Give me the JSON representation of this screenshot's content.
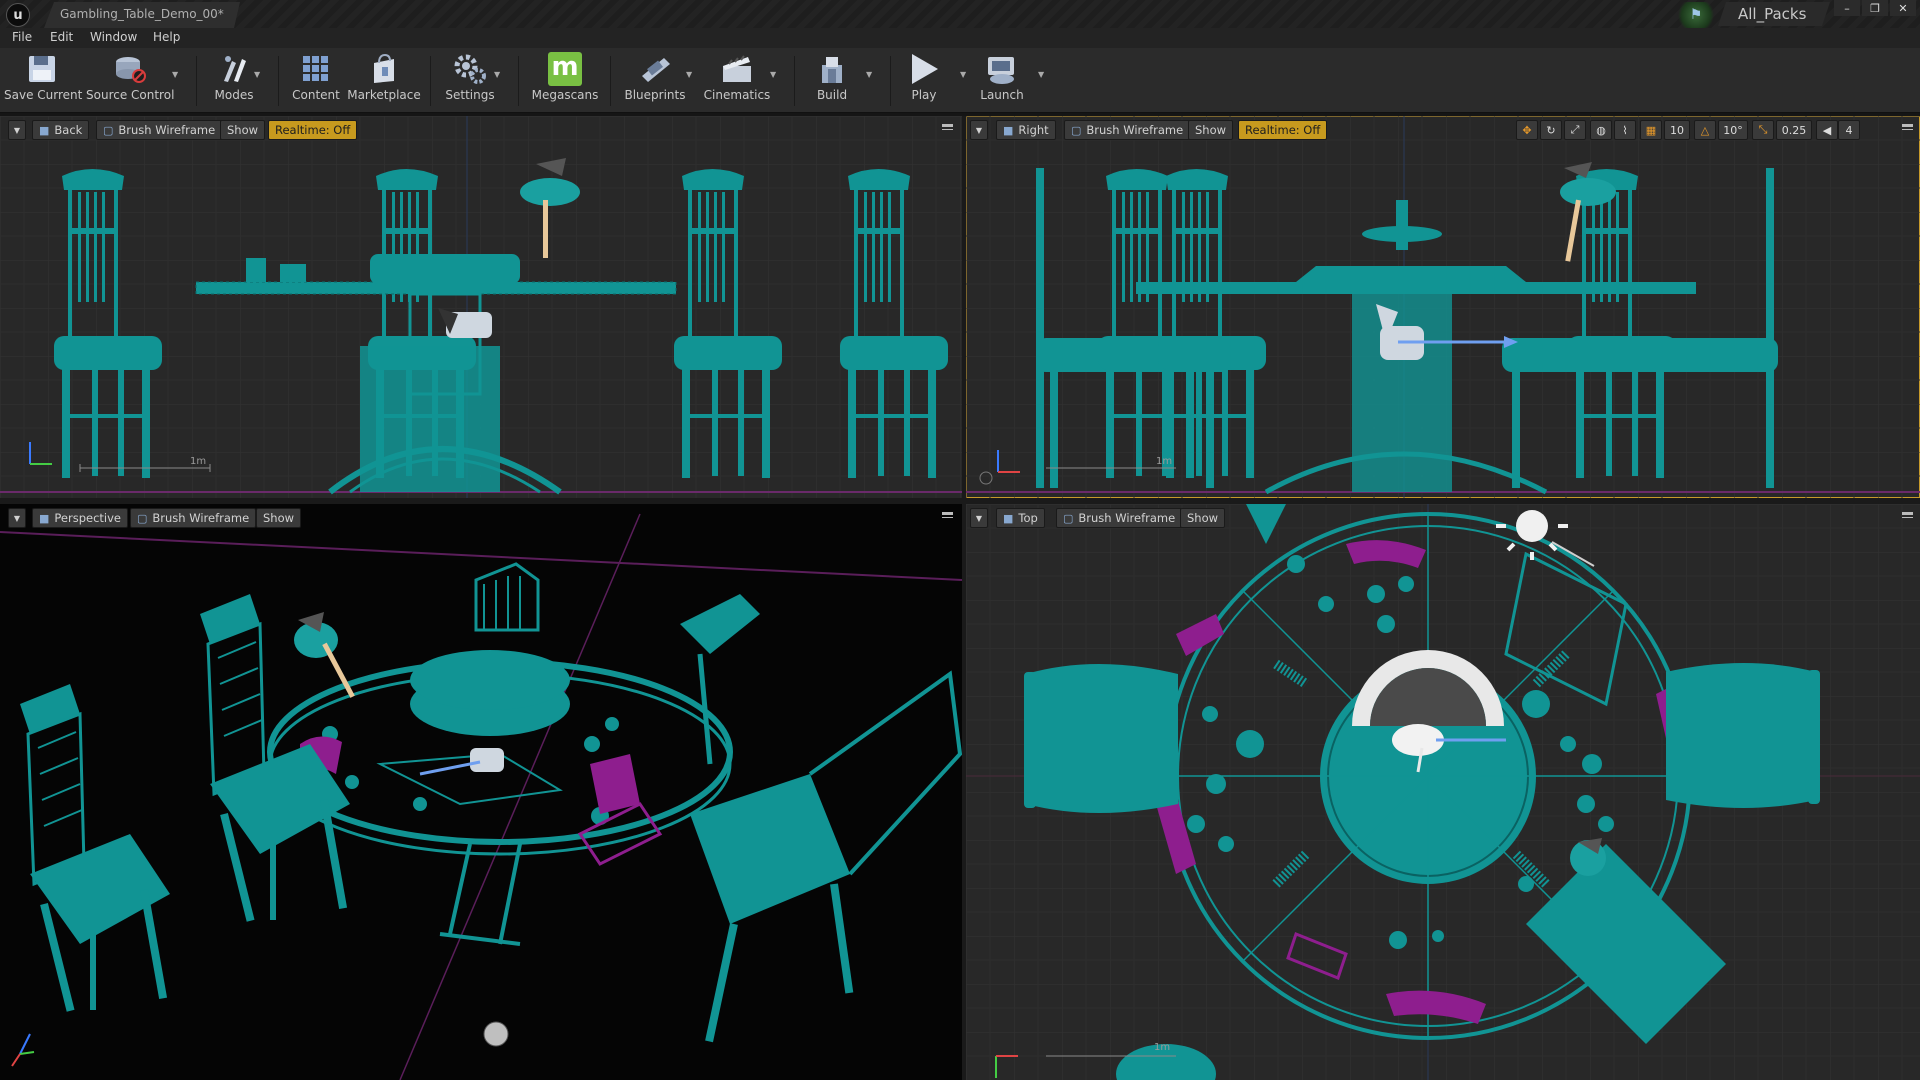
{
  "window": {
    "tab_title": "Gambling_Table_Demo_00*",
    "project_name": "All_Packs",
    "minimize": "–",
    "restore": "❐",
    "close": "✕"
  },
  "menu": [
    "File",
    "Edit",
    "Window",
    "Help"
  ],
  "toolbar": [
    {
      "id": "save-current",
      "label": "Save Current",
      "icon": "floppy-disk-icon",
      "glyph": "💾"
    },
    {
      "id": "source-control",
      "label": "Source Control",
      "icon": "source-control-icon",
      "glyph": "⛁"
    },
    {
      "id": "modes",
      "label": "Modes",
      "icon": "modes-icon",
      "glyph": "✎"
    },
    {
      "id": "content",
      "label": "Content",
      "icon": "content-grid-icon",
      "glyph": "▦"
    },
    {
      "id": "marketplace",
      "label": "Marketplace",
      "icon": "marketplace-icon",
      "glyph": "🛍"
    },
    {
      "id": "settings",
      "label": "Settings",
      "icon": "gear-icon",
      "glyph": "⚙"
    },
    {
      "id": "megascans",
      "label": "Megascans",
      "icon": "megascans-icon",
      "glyph": "m"
    },
    {
      "id": "blueprints",
      "label": "Blueprints",
      "icon": "blueprints-icon",
      "glyph": "⌨"
    },
    {
      "id": "cinematics",
      "label": "Cinematics",
      "icon": "clapperboard-icon",
      "glyph": "🎬"
    },
    {
      "id": "build",
      "label": "Build",
      "icon": "build-icon",
      "glyph": "▣"
    },
    {
      "id": "play",
      "label": "Play",
      "icon": "play-icon",
      "glyph": "▶"
    },
    {
      "id": "launch",
      "label": "Launch",
      "icon": "launch-icon",
      "glyph": "🎮"
    }
  ],
  "viewports": {
    "back": {
      "view": "Back",
      "mode": "Brush Wireframe",
      "show": "Show",
      "realtime": "Realtime: Off",
      "scale": "1m"
    },
    "right": {
      "view": "Right",
      "mode": "Brush Wireframe",
      "show": "Show",
      "realtime": "Realtime: Off",
      "scale": "1m",
      "snap": {
        "grid": "10",
        "rotation": "10°",
        "scale": "0.25",
        "camera_speed": "4"
      }
    },
    "perspective": {
      "view": "Perspective",
      "mode": "Brush Wireframe",
      "show": "Show"
    },
    "top": {
      "view": "Top",
      "mode": "Brush Wireframe",
      "show": "Show",
      "scale": "1m"
    }
  },
  "colors": {
    "mesh": "#119494",
    "selected": "#8e1e8e",
    "grid": "#3a3a3a",
    "active_border": "#c79a2a",
    "realtime_chip": "#c79a1e"
  }
}
